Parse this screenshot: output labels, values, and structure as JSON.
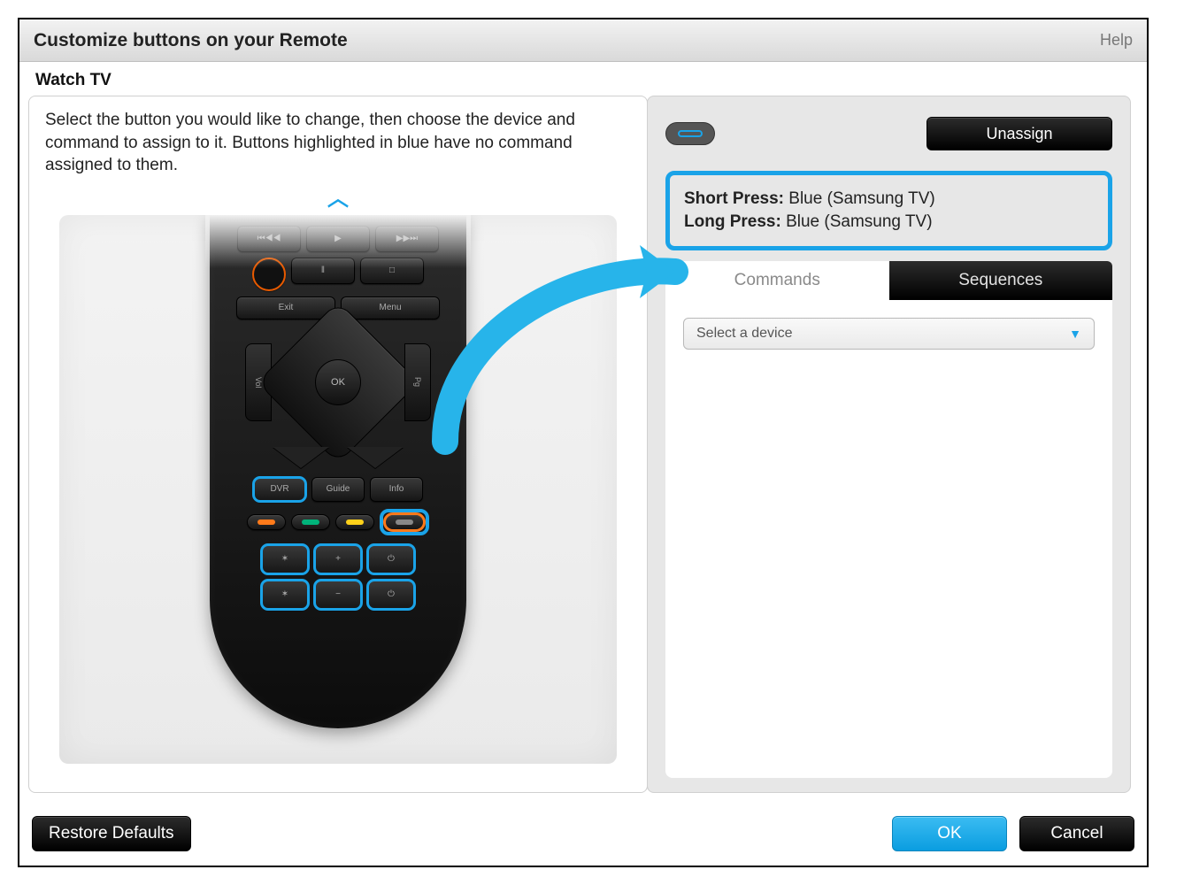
{
  "titlebar": {
    "title": "Customize buttons on your Remote",
    "help": "Help"
  },
  "section": {
    "name": "Watch TV"
  },
  "instructions": "Select the button you would like to change, then choose the device and command to assign to it. Buttons highlighted in blue have no command assigned to them.",
  "remote": {
    "row_top": [
      "⏮◀◀",
      "▶",
      "▶▶⏭"
    ],
    "row_ps": [
      "‖",
      "□"
    ],
    "row_wide": [
      "Exit",
      "Menu"
    ],
    "ok": "OK",
    "side_l": "Vol",
    "side_r": "Pg",
    "row_info": [
      "DVR",
      "Guide",
      "Info"
    ],
    "color_pills": [
      "#ff7a1a",
      "#00b37a",
      "#ffd11a",
      "#888888"
    ],
    "extra_grid": [
      "light",
      "+",
      "socket",
      "light",
      "−",
      "socket"
    ]
  },
  "right": {
    "unassign": "Unassign",
    "short_press_label": "Short Press:",
    "short_press_value": "Blue (Samsung TV)",
    "long_press_label": "Long Press:",
    "long_press_value": "Blue (Samsung TV)",
    "tab_commands": "Commands",
    "tab_sequences": "Sequences",
    "select_placeholder": "Select a device"
  },
  "footer": {
    "restore": "Restore Defaults",
    "ok": "OK",
    "cancel": "Cancel"
  }
}
